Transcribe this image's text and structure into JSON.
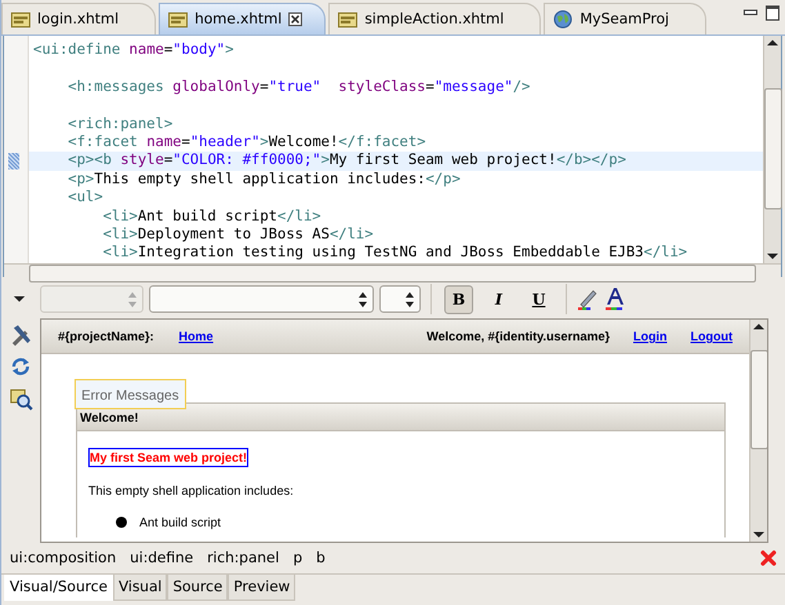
{
  "editor_tabs": [
    {
      "label": "login.xhtml",
      "kind": "file",
      "selected": false
    },
    {
      "label": "home.xhtml",
      "kind": "file",
      "selected": true
    },
    {
      "label": "simpleAction.xhtml",
      "kind": "file",
      "selected": false
    },
    {
      "label": "MySeamProj",
      "kind": "project",
      "selected": false
    }
  ],
  "source_editor": {
    "lines": [
      {
        "kind": "code",
        "highlighted": false,
        "tokens": [
          {
            "kind": "tag",
            "text": "<ui:define "
          },
          {
            "kind": "attr",
            "text": "name"
          },
          {
            "kind": "text",
            "text": "="
          },
          {
            "kind": "value",
            "text": "\"body\""
          },
          {
            "kind": "tag",
            "text": ">"
          }
        ]
      },
      {
        "kind": "blank"
      },
      {
        "kind": "code",
        "highlighted": false,
        "tokens": [
          {
            "kind": "tag",
            "text": "    <h:messages "
          },
          {
            "kind": "attr",
            "text": "globalOnly"
          },
          {
            "kind": "text",
            "text": "="
          },
          {
            "kind": "value",
            "text": "\"true\""
          },
          {
            "kind": "attr",
            "text": "  styleClass"
          },
          {
            "kind": "text",
            "text": "="
          },
          {
            "kind": "value",
            "text": "\"message\""
          },
          {
            "kind": "tag",
            "text": "/>"
          }
        ]
      },
      {
        "kind": "blank"
      },
      {
        "kind": "code",
        "highlighted": false,
        "tokens": [
          {
            "kind": "tag",
            "text": "    <rich:panel>"
          }
        ]
      },
      {
        "kind": "code",
        "highlighted": false,
        "tokens": [
          {
            "kind": "tag",
            "text": "    <f:facet "
          },
          {
            "kind": "attr",
            "text": "name"
          },
          {
            "kind": "text",
            "text": "="
          },
          {
            "kind": "value",
            "text": "\"header\""
          },
          {
            "kind": "tag",
            "text": ">"
          },
          {
            "kind": "text",
            "text": "Welcome!"
          },
          {
            "kind": "tag",
            "text": "</f:facet>"
          }
        ]
      },
      {
        "kind": "code",
        "highlighted": true,
        "tokens": [
          {
            "kind": "tag",
            "text": "    <p><b "
          },
          {
            "kind": "attr",
            "text": "style"
          },
          {
            "kind": "text",
            "text": "="
          },
          {
            "kind": "value",
            "text": "\"COLOR: #ff0000;\""
          },
          {
            "kind": "tag",
            "text": ">"
          },
          {
            "kind": "text",
            "text": "My first Seam web project!"
          },
          {
            "kind": "tag",
            "text": "</b></p>"
          }
        ]
      },
      {
        "kind": "code",
        "highlighted": false,
        "tokens": [
          {
            "kind": "tag",
            "text": "    <p>"
          },
          {
            "kind": "text",
            "text": "This empty shell application includes:"
          },
          {
            "kind": "tag",
            "text": "</p>"
          }
        ]
      },
      {
        "kind": "code",
        "highlighted": false,
        "tokens": [
          {
            "kind": "tag",
            "text": "    <ul>"
          }
        ]
      },
      {
        "kind": "code",
        "highlighted": false,
        "tokens": [
          {
            "kind": "tag",
            "text": "        <li>"
          },
          {
            "kind": "text",
            "text": "Ant build script"
          },
          {
            "kind": "tag",
            "text": "</li>"
          }
        ]
      },
      {
        "kind": "code",
        "highlighted": false,
        "tokens": [
          {
            "kind": "tag",
            "text": "        <li>"
          },
          {
            "kind": "text",
            "text": "Deployment to JBoss AS"
          },
          {
            "kind": "tag",
            "text": "</li>"
          }
        ]
      },
      {
        "kind": "code",
        "highlighted": false,
        "tokens": [
          {
            "kind": "tag",
            "text": "        <li>"
          },
          {
            "kind": "text",
            "text": "Integration testing using TestNG and JBoss Embeddable EJB3"
          },
          {
            "kind": "tag",
            "text": "</li>"
          }
        ]
      }
    ]
  },
  "format_toolbar": {
    "combos": [
      {
        "kind": "style",
        "disabled": true
      },
      {
        "kind": "font",
        "disabled": false
      },
      {
        "kind": "size",
        "disabled": false
      }
    ],
    "buttons": [
      {
        "label": "B",
        "kind": "bold",
        "selected": true
      },
      {
        "label": "I",
        "kind": "italic",
        "selected": false
      },
      {
        "label": "U",
        "kind": "underline",
        "selected": false
      }
    ]
  },
  "visual_preview": {
    "header": {
      "project_name": "#{projectName}:",
      "home_link": "Home",
      "welcome": "Welcome, #{identity.username}",
      "login_link": "Login",
      "logout_link": "Logout"
    },
    "messages_label": "Error Messages",
    "panel": {
      "header": "Welcome!",
      "highlight_text": "My first Seam web project!",
      "paragraph": "This empty shell application includes:",
      "list_items": [
        "Ant build script"
      ]
    }
  },
  "breadcrumb": [
    "ui:composition",
    "ui:define",
    "rich:panel",
    "p",
    "b"
  ],
  "mode_tabs": [
    {
      "label": "Visual/Source",
      "selected": true
    },
    {
      "label": "Visual",
      "selected": false
    },
    {
      "label": "Source",
      "selected": false
    },
    {
      "label": "Preview",
      "selected": false
    }
  ]
}
